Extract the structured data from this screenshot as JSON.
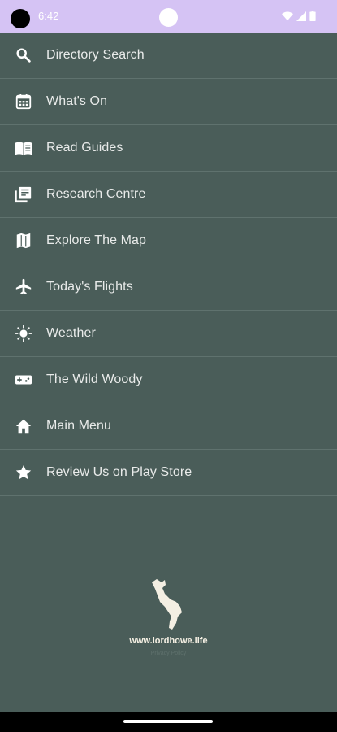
{
  "status_bar": {
    "time": "6:42",
    "background": "#d5c3f4",
    "icons": [
      "wifi-icon",
      "cellular-signal-icon",
      "battery-icon"
    ]
  },
  "menu": {
    "items": [
      {
        "label": "Directory Search",
        "icon": "search-icon"
      },
      {
        "label": "What's On",
        "icon": "calendar-icon"
      },
      {
        "label": "Read Guides",
        "icon": "book-icon"
      },
      {
        "label": "Research Centre",
        "icon": "newspaper-icon"
      },
      {
        "label": "Explore The Map",
        "icon": "map-icon"
      },
      {
        "label": "Today's Flights",
        "icon": "airplane-icon"
      },
      {
        "label": "Weather",
        "icon": "sun-icon"
      },
      {
        "label": "The Wild Woody",
        "icon": "gamepad-icon"
      },
      {
        "label": "Main Menu",
        "icon": "home-icon"
      },
      {
        "label": "Review Us on Play Store",
        "icon": "star-icon"
      }
    ]
  },
  "footer": {
    "url": "www.lordhowe.life",
    "privacy": "Privacy Policy"
  },
  "colors": {
    "background": "#4a5d59",
    "text": "#e9ebea",
    "divider": "#5f726e"
  }
}
